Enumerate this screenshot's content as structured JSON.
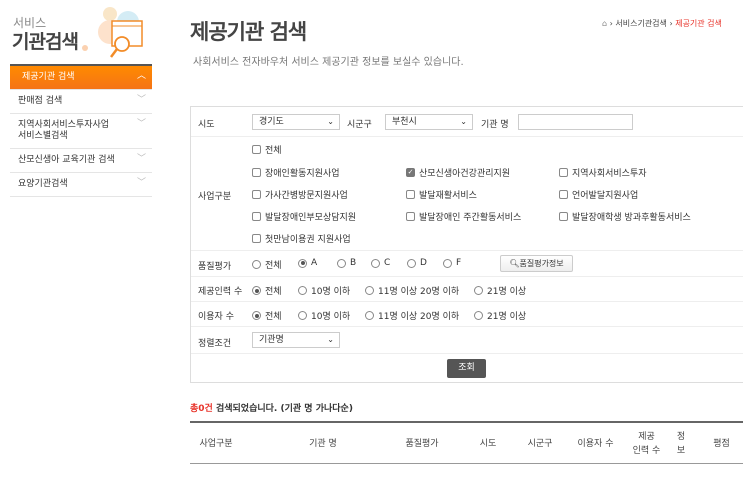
{
  "sidebar": {
    "logo_small": "서비스",
    "logo_large": "기관검색",
    "items": [
      {
        "label": "제공기관 검색",
        "active": true
      },
      {
        "label": "판매점 검색"
      },
      {
        "label": "지역사회서비스투자사업\n서비스별검색"
      },
      {
        "label": "산모신생아 교육기관 검색"
      },
      {
        "label": "요양기관검색"
      }
    ]
  },
  "header": {
    "title": "제공기관 검색",
    "subtitle": "사회서비스 전자바우처 서비스 제공기관 정보를 보실수 있습니다.",
    "breadcrumb": [
      "서비스기관검색",
      "제공기관 검색"
    ]
  },
  "form": {
    "sido_label": "시도",
    "sido_value": "경기도",
    "sigungu_label": "시군구",
    "sigungu_value": "부천시",
    "name_label": "기관 명",
    "name_value": "",
    "biz_label": "사업구분",
    "biz_all": "전체",
    "biz_options": [
      {
        "label": "장애인활동지원사업",
        "checked": false
      },
      {
        "label": "산모신생아건강관리지원",
        "checked": true
      },
      {
        "label": "지역사회서비스투자",
        "checked": false
      },
      {
        "label": "가사간병방문지원사업",
        "checked": false
      },
      {
        "label": "발달재활서비스",
        "checked": false
      },
      {
        "label": "언어발달지원사업",
        "checked": false
      },
      {
        "label": "발달장애인부모상담지원",
        "checked": false
      },
      {
        "label": "발달장애인 주간활동서비스",
        "checked": false
      },
      {
        "label": "발달장애학생 방과후활동서비스",
        "checked": false
      },
      {
        "label": "첫만남이용권 지원사업",
        "checked": false
      }
    ],
    "quality_label": "품질평가",
    "quality_options": [
      "전체",
      "A",
      "B",
      "C",
      "D",
      "F"
    ],
    "quality_selected": "A",
    "quality_info_button": "품질평가정보",
    "staff_label": "제공인력 수",
    "staff_options": [
      "전체",
      "10명 이하",
      "11명 이상 20명 이하",
      "21명 이상"
    ],
    "users_label": "이용자 수",
    "users_options": [
      "전체",
      "10명 이하",
      "11명 이상 20명 이하",
      "21명 이상"
    ],
    "sort_label": "정렬조건",
    "sort_value": "기관명",
    "search_button": "조회"
  },
  "result": {
    "count": "총0건",
    "text": " 검색되었습니다. (기관 명 가나다순)"
  },
  "table": {
    "headers": [
      "사업구분",
      "기관 명",
      "품질평가",
      "시도",
      "시군구",
      "이용자 수",
      "제공\n인력 수",
      "정\n보",
      "평점"
    ]
  }
}
